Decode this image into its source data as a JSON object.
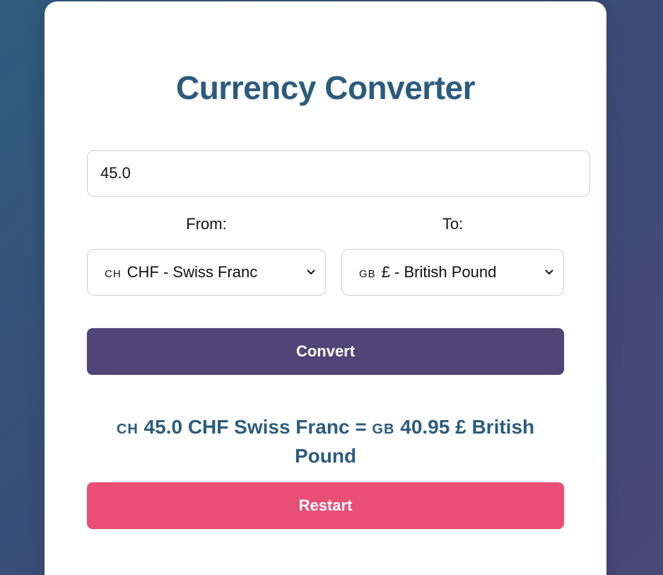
{
  "app": {
    "title": "Currency Converter"
  },
  "amount": {
    "value": "45.0"
  },
  "from": {
    "label": "From:",
    "flag": "CH",
    "selected": "CHF - Swiss Franc"
  },
  "to": {
    "label": "To:",
    "flag": "GB",
    "selected": "£ - British Pound"
  },
  "actions": {
    "convert_label": "Convert",
    "restart_label": "Restart"
  },
  "result": {
    "from_flag": "CH",
    "from_text": "45.0 CHF Swiss Franc = ",
    "to_flag": "GB",
    "to_text": "40.95 £ British Pound"
  },
  "colors": {
    "title": "#2b5b7d",
    "convert_button": "#4f4677",
    "restart_button": "#e94f75"
  },
  "icons": {
    "select_arrow": "chevron-down-icon"
  }
}
